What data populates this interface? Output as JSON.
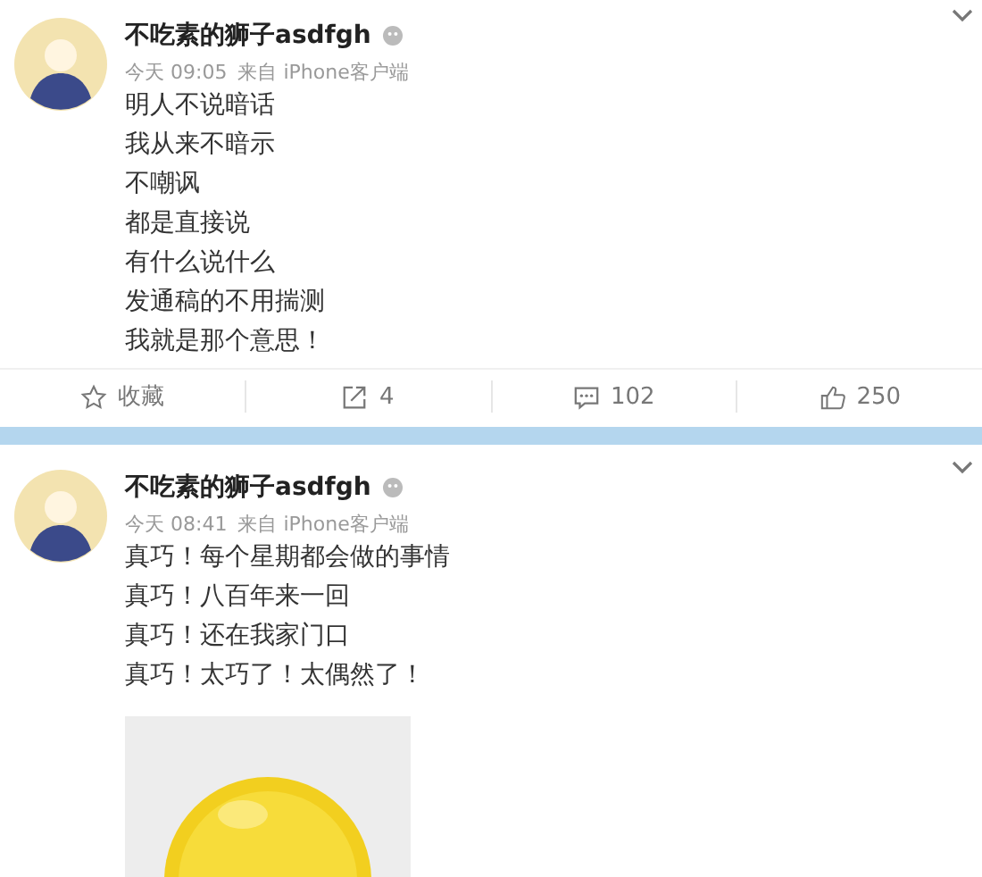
{
  "posts": [
    {
      "author": "不吃素的狮子asdfgh",
      "time": "今天 09:05",
      "source": "来自 iPhone客户端",
      "lines": [
        "明人不说暗话",
        "我从来不暗示",
        "不嘲讽",
        "都是直接说",
        "有什么说什么",
        "发通稿的不用揣测",
        "我就是那个意思！"
      ],
      "actions": [
        {
          "kind": "favorite",
          "label": "收藏"
        },
        {
          "kind": "repost",
          "label": "4"
        },
        {
          "kind": "comment",
          "label": "102"
        },
        {
          "kind": "like",
          "label": "250"
        }
      ]
    },
    {
      "author": "不吃素的狮子asdfgh",
      "time": "今天 08:41",
      "source": "来自 iPhone客户端",
      "lines": [
        "真巧！每个星期都会做的事情",
        "真巧！八百年来一回",
        "真巧！还在我家门口",
        "真巧！太巧了！太偶然了！"
      ]
    }
  ]
}
